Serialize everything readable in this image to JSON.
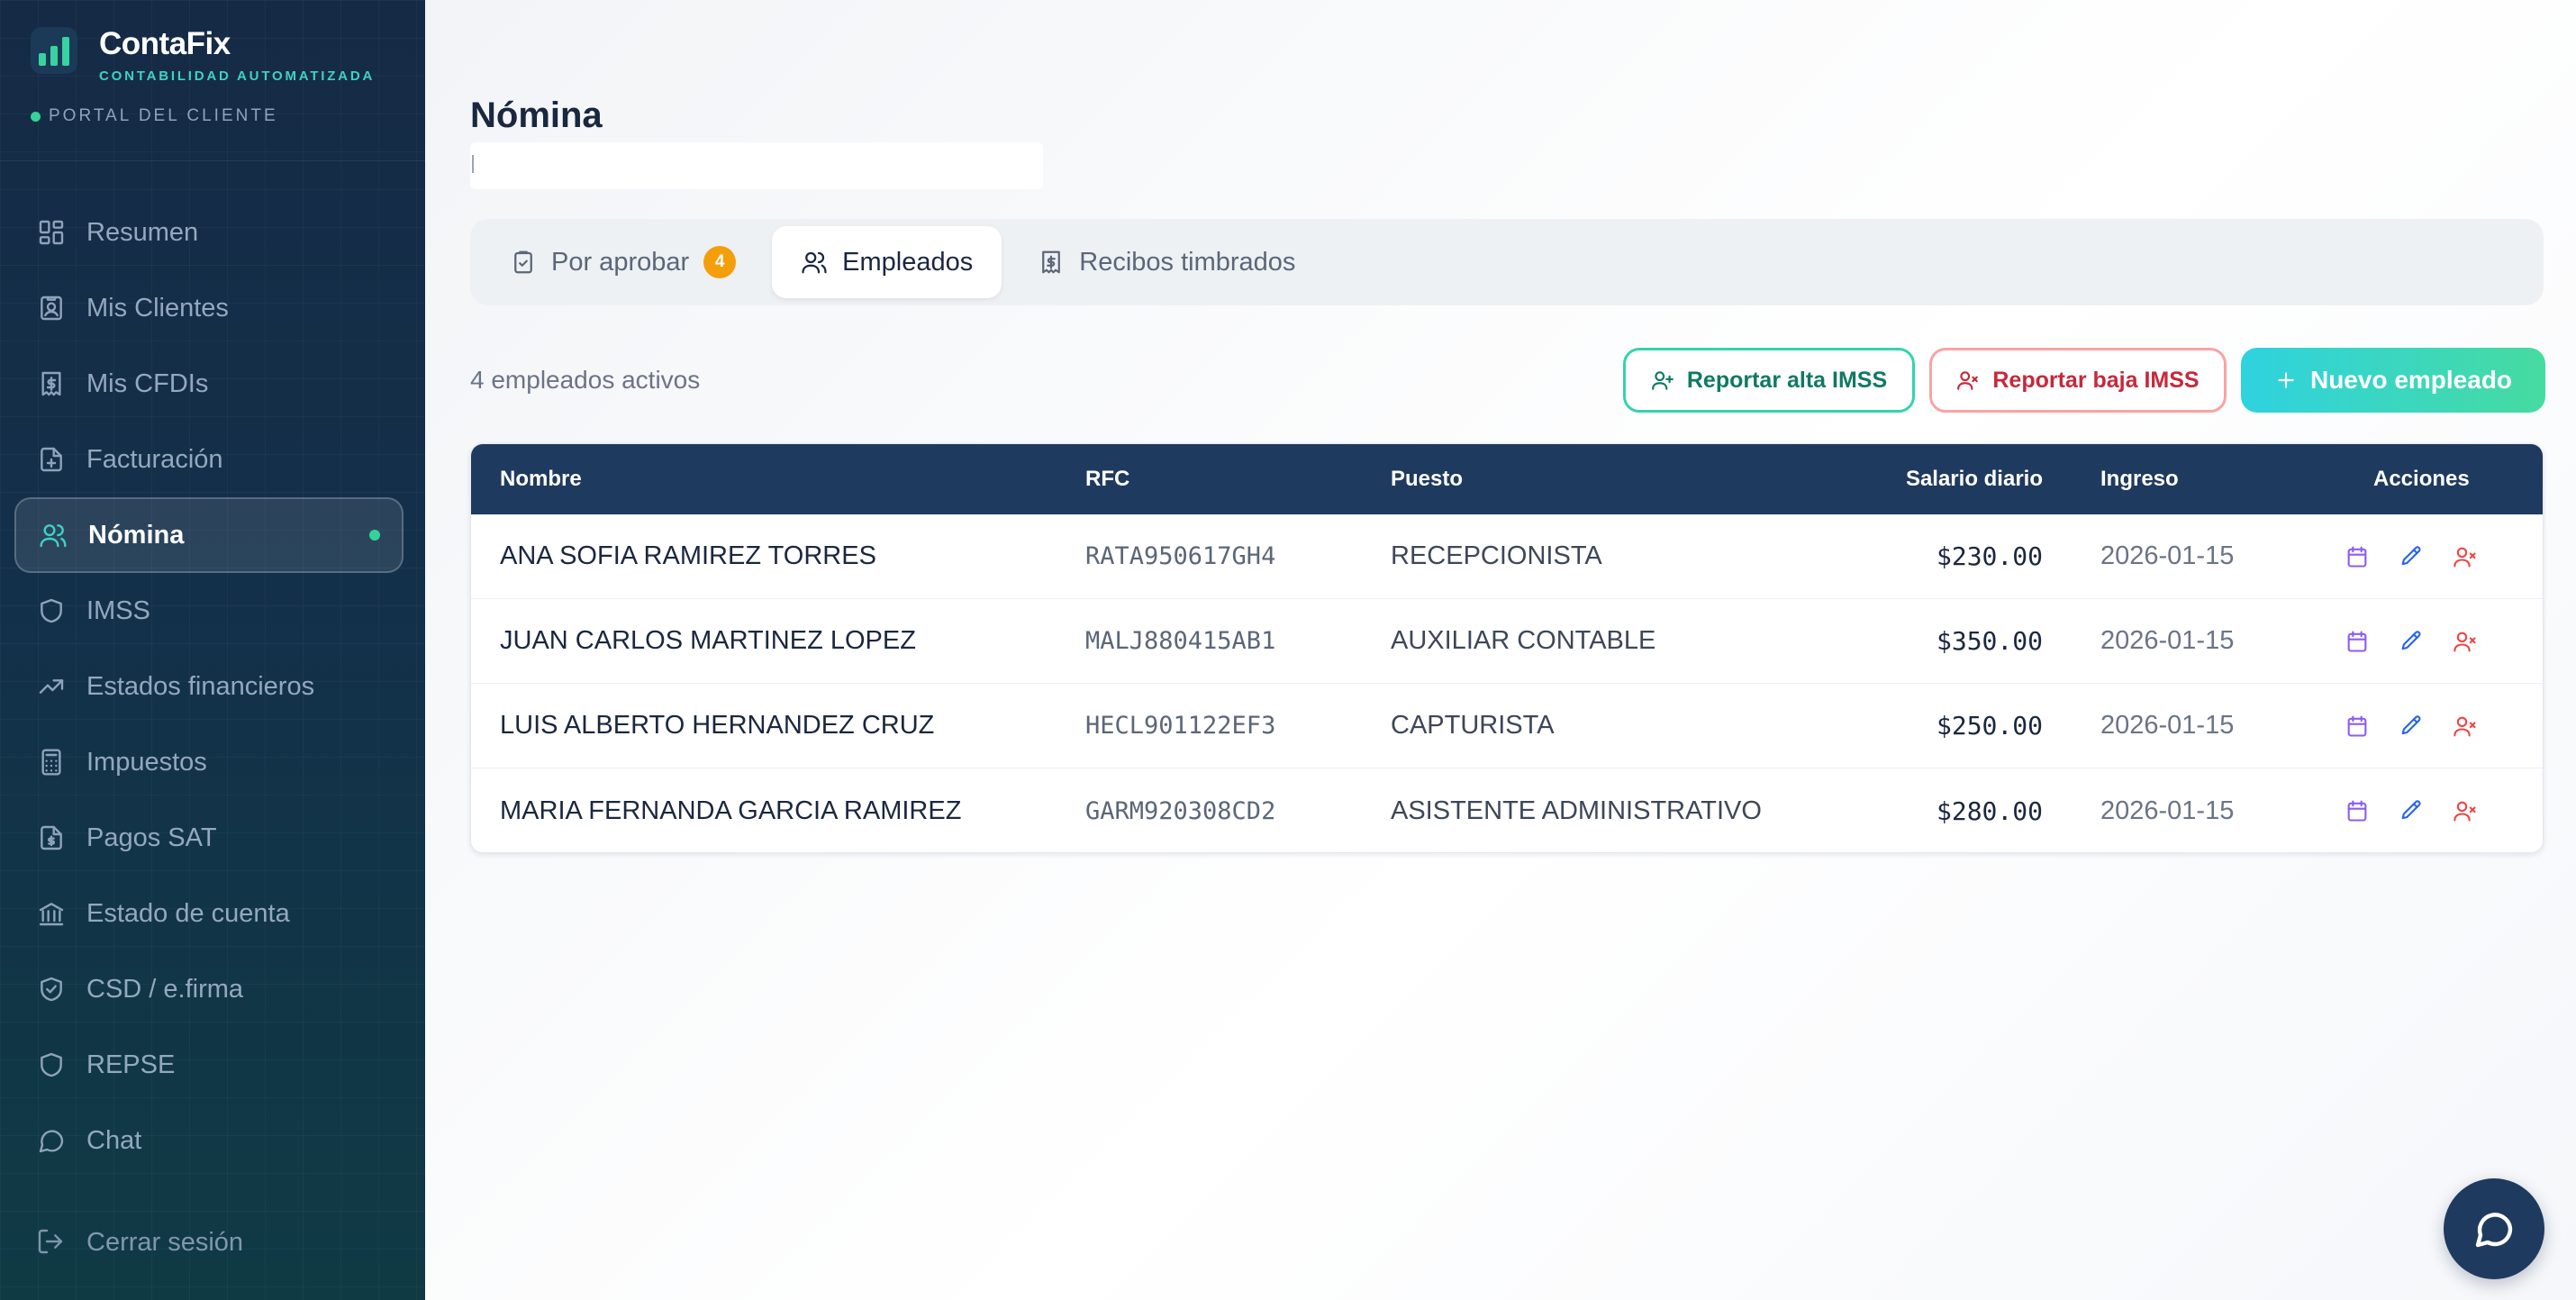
{
  "brand": {
    "name": "ContaFix",
    "tagline": "CONTABILIDAD AUTOMATIZADA",
    "portal_label": "PORTAL DEL CLIENTE"
  },
  "sidebar": {
    "items": [
      {
        "label": "Resumen",
        "icon": "grid-icon"
      },
      {
        "label": "Mis Clientes",
        "icon": "contact-card-icon"
      },
      {
        "label": "Mis CFDIs",
        "icon": "invoice-icon"
      },
      {
        "label": "Facturación",
        "icon": "file-plus-icon"
      },
      {
        "label": "Nómina",
        "icon": "users-icon",
        "active": true
      },
      {
        "label": "IMSS",
        "icon": "shield-icon"
      },
      {
        "label": "Estados financieros",
        "icon": "trending-up-icon"
      },
      {
        "label": "Impuestos",
        "icon": "calculator-icon"
      },
      {
        "label": "Pagos SAT",
        "icon": "file-dollar-icon"
      },
      {
        "label": "Estado de cuenta",
        "icon": "bank-icon"
      },
      {
        "label": "CSD / e.firma",
        "icon": "shield-check-icon"
      },
      {
        "label": "REPSE",
        "icon": "shield-icon"
      },
      {
        "label": "Chat",
        "icon": "chat-bubble-icon"
      }
    ],
    "logout_label": "Cerrar sesión"
  },
  "page": {
    "title": "Nómina"
  },
  "tabs": [
    {
      "label": "Por aprobar",
      "badge": "4",
      "icon": "clipboard-check-icon"
    },
    {
      "label": "Empleados",
      "icon": "users-icon",
      "active": true
    },
    {
      "label": "Recibos timbrados",
      "icon": "receipt-icon"
    }
  ],
  "toolbar": {
    "count_label": "4 empleados activos",
    "alta_label": "Reportar alta IMSS",
    "baja_label": "Reportar baja IMSS",
    "nuevo_label": "Nuevo empleado"
  },
  "table": {
    "headers": {
      "nombre": "Nombre",
      "rfc": "RFC",
      "puesto": "Puesto",
      "salario": "Salario diario",
      "ingreso": "Ingreso",
      "acciones": "Acciones"
    },
    "rows": [
      {
        "nombre": "ANA SOFIA RAMIREZ TORRES",
        "rfc": "RATA950617GH4",
        "puesto": "RECEPCIONISTA",
        "salario": "$230.00",
        "ingreso": "2026-01-15"
      },
      {
        "nombre": "JUAN CARLOS MARTINEZ LOPEZ",
        "rfc": "MALJ880415AB1",
        "puesto": "AUXILIAR CONTABLE",
        "salario": "$350.00",
        "ingreso": "2026-01-15"
      },
      {
        "nombre": "LUIS ALBERTO HERNANDEZ CRUZ",
        "rfc": "HECL901122EF3",
        "puesto": "CAPTURISTA",
        "salario": "$250.00",
        "ingreso": "2026-01-15"
      },
      {
        "nombre": "MARIA FERNANDA GARCIA RAMIREZ",
        "rfc": "GARM920308CD2",
        "puesto": "ASISTENTE ADMINISTRATIVO",
        "salario": "$280.00",
        "ingreso": "2026-01-15"
      }
    ]
  },
  "colors": {
    "sidebar_bg": "#152a45",
    "accent_teal": "#3fd1c6",
    "active_dot": "#34d399",
    "table_header": "#1f3a5f",
    "badge_orange": "#f59e0b",
    "danger": "#c8283a"
  }
}
